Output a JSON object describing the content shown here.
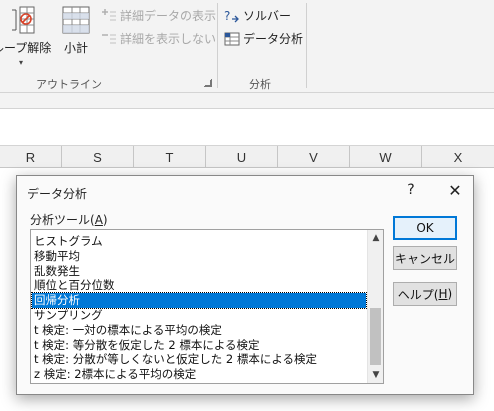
{
  "ribbon": {
    "ungroup_label": "ループ解除",
    "subtotal_label": "小計",
    "show_detail_label": "詳細データの表示",
    "hide_detail_label": "詳細を表示しない",
    "outline_group_label": "アウトライン",
    "solver_label": "ソルバー",
    "data_analysis_label": "データ分析",
    "analysis_group_label": "分析"
  },
  "columns": [
    "R",
    "S",
    "T",
    "U",
    "V",
    "W",
    "X"
  ],
  "dialog": {
    "title": "データ分析",
    "help_glyph": "?",
    "close_glyph": "✕",
    "tools_label_prefix": "分析ツール(",
    "tools_label_key": "A",
    "tools_label_suffix": ")",
    "items": [
      "ヒストグラム",
      "移動平均",
      "乱数発生",
      "順位と百分位数",
      "回帰分析",
      "サンプリング",
      "t 検定:  一対の標本による平均の検定",
      "t 検定:  等分散を仮定した 2 標本による検定",
      "t 検定:  分散が等しくないと仮定した 2 標本による検定",
      "z 検定:  2標本による平均の検定"
    ],
    "selected_item": "回帰分析",
    "ok_label": "OK",
    "cancel_label": "キャンセル",
    "help_label_prefix": "ヘルプ(",
    "help_label_key": "H",
    "help_label_suffix": ")"
  },
  "colors": {
    "selection": "#0078d7",
    "ribbon_bg": "#f3f3f3"
  }
}
